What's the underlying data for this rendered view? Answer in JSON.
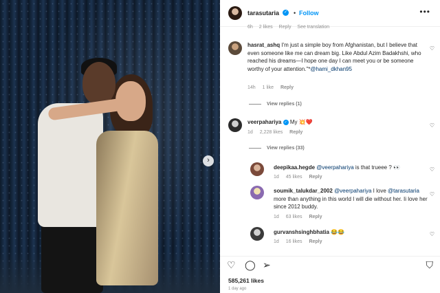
{
  "header": {
    "username": "tarasutaria",
    "verified_mark": "✓",
    "separator": "•",
    "follow_label": "Follow",
    "more_label": "•••"
  },
  "photo": {
    "next_label": "›"
  },
  "cut_comment": {
    "time": "6h",
    "likes": "2 likes",
    "reply_label": "Reply",
    "translate_label": "See translation"
  },
  "comments": [
    {
      "user": "hasrat_ashq",
      "text": "I'm just a simple boy from Afghanistan, but I believe that even someone like me can dream big. Like Abdul Azim Badakhshi, who reached his dreams—I hope one day I can meet you or be someone worthy of your attention.\"*",
      "mention": "@hami_dkhan95",
      "time": "14h",
      "likes": "1 like",
      "reply_label": "Reply",
      "view_replies": "View replies (1)"
    },
    {
      "user": "veerpahariya",
      "text": "My",
      "emoji": "💥❤️",
      "time": "1d",
      "likes": "2,228 likes",
      "reply_label": "Reply",
      "view_replies": "View replies (33)"
    },
    {
      "user": "deepikaa.hegde",
      "mention": "@veerpahariya",
      "text": "is that trueee ?",
      "emoji": "👀",
      "time": "1d",
      "likes": "45 likes",
      "reply_label": "Reply"
    },
    {
      "user": "soumik_talukdar_2002",
      "mention": "@veerpahariya",
      "text_a": "I love",
      "mention2": "@tarasutaria",
      "text_b": "more than anything in this world I will die without her. Ii love her since 2012 buddy.",
      "time": "1d",
      "likes": "63 likes",
      "reply_label": "Reply"
    },
    {
      "user": "gurvanshsinghbhatia",
      "emoji": "😂😂",
      "time": "1d",
      "likes": "16 likes",
      "reply_label": "Reply"
    }
  ],
  "heart_icon": "♡",
  "actions": {
    "like_icon": "♡",
    "comment_icon": "◯",
    "share_icon": "➢",
    "save_icon": "⛉"
  },
  "post": {
    "likes": "585,261 likes",
    "timestamp": "1 day ago"
  },
  "colors": {
    "accent": "#0095f6",
    "text": "#262626",
    "muted": "#8e8e8e",
    "mention": "#00376b"
  }
}
